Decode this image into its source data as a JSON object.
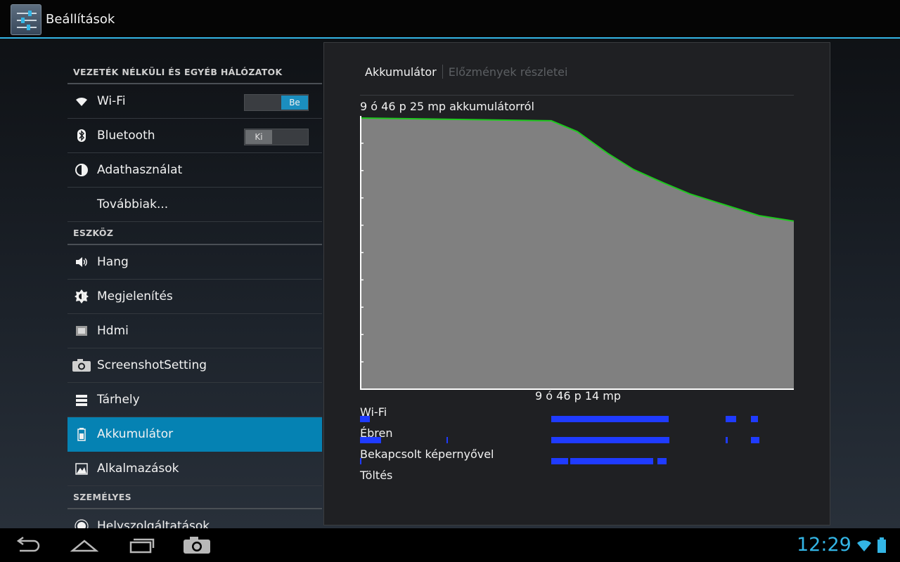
{
  "action_bar": {
    "title": "Beállítások",
    "icon": "settings-sliders-icon"
  },
  "sections": {
    "wireless": "VEZETÉK NÉLKÜLI ÉS EGYÉB HÁLÓZATOK",
    "device": "ESZKÖZ",
    "personal": "SZEMÉLYES"
  },
  "items": {
    "wifi": {
      "label": "Wi-Fi",
      "toggle": "Be",
      "icon": "wifi-icon"
    },
    "bluetooth": {
      "label": "Bluetooth",
      "toggle": "Ki",
      "icon": "bluetooth-icon"
    },
    "data_usage": {
      "label": "Adathasználat",
      "icon": "data-usage-icon"
    },
    "more": {
      "label": "Továbbiak..."
    },
    "sound": {
      "label": "Hang",
      "icon": "volume-icon"
    },
    "display": {
      "label": "Megjelenítés",
      "icon": "brightness-icon"
    },
    "hdmi": {
      "label": "Hdmi",
      "icon": "hdmi-icon"
    },
    "screenshot": {
      "label": "ScreenshotSetting",
      "icon": "camera-icon"
    },
    "storage": {
      "label": "Tárhely",
      "icon": "storage-icon"
    },
    "battery": {
      "label": "Akkumulátor",
      "icon": "battery-icon"
    },
    "apps": {
      "label": "Alkalmazások",
      "icon": "apps-icon"
    },
    "location": {
      "label": "Helyszolgáltatások",
      "icon": "location-icon"
    }
  },
  "detail": {
    "tab_active": "Akkumulátor",
    "tab_inactive": "Előzmények részletei",
    "graph_caption": "9 ó 46 p 25 mp akkumulátorról",
    "graph_time": "9 ó 46 p 14 mp",
    "signals": {
      "wifi": "Wi-Fi",
      "awake": "Ébren",
      "screen_on": "Bekapcsolt képernyővel",
      "charging": "Töltés"
    }
  },
  "status": {
    "clock": "12:29"
  },
  "colors": {
    "accent": "#33b5e5",
    "selected_row": "#0582b3",
    "graph_fill": "#808080",
    "graph_line": "#1ec81e",
    "signal_bar": "#1f3bff"
  },
  "chart_data": {
    "type": "area",
    "x_fraction": [
      0,
      0.44,
      0.5,
      0.57,
      0.63,
      0.7,
      0.76,
      0.84,
      0.92,
      1.0
    ],
    "battery_level_fraction": [
      1.0,
      0.99,
      0.95,
      0.87,
      0.81,
      0.76,
      0.72,
      0.68,
      0.64,
      0.62
    ],
    "ylim": [
      0,
      1
    ]
  }
}
